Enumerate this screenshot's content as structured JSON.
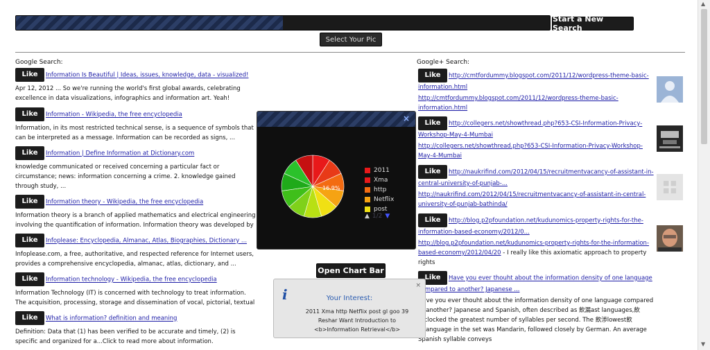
{
  "toolbar": {
    "progress": 0.5,
    "new_search_label": "Start a New Search",
    "select_pic_label": "Select Your Pic"
  },
  "google": {
    "title": "Google Search:",
    "like_label": "Like",
    "results": [
      {
        "title": "Information Is Beautiful | Ideas, issues, knowledge, data - visualized!",
        "snippet": "Apr 12, 2012 ... So we're running the world's first global awards, celebrating excellence in data visualizations, infographics and information art. Yeah!"
      },
      {
        "title": "Information - Wikipedia, the free encyclopedia",
        "snippet": "Information, in its most restricted technical sense, is a sequence of symbols that can be interpreted as a message. Information can be recorded as signs, ..."
      },
      {
        "title": "Information | Define Information at Dictionary.com",
        "snippet": "knowledge communicated or received concerning a particular fact or circumstance; news: information concerning a crime. 2. knowledge gained through study, ..."
      },
      {
        "title": "Information theory - Wikipedia, the free encyclopedia",
        "snippet": "Information theory is a branch of applied mathematics and electrical engineering involving the quantification of information. Information theory was developed by ..."
      },
      {
        "title": "Infoplease: Encyclopedia, Almanac, Atlas, Biographies, Dictionary ...",
        "snippet": "Infoplease.com, a free, authoritative, and respected reference for Internet users, provides a comprehensive encyclopedia, almanac, atlas, dictionary, and ..."
      },
      {
        "title": "Information technology - Wikipedia, the free encyclopedia",
        "snippet": "Information Technology (IT) is concerned with technology to treat information. The acquisition, processing, storage and dissemination of vocal, pictorial, textual ..."
      },
      {
        "title": "What is information? definition and meaning",
        "snippet": "Definition: Data that (1) has been verified to be accurate and timely, (2) is specific and organized for a...Click to read more about information."
      }
    ]
  },
  "gplus": {
    "title": "Google+ Search:",
    "like_label": "Like",
    "results": [
      {
        "link1": "http://cmtfordummy.blogspot.com/2011/12/wordpress-theme-basic-information.html",
        "link2": "http://cmtfordummy.blogspot.com/2011/12/wordpress-theme-basic-information.html",
        "text": ""
      },
      {
        "link1": "http://collegers.net/showthread.php?653-CSI-Information-Privacy-Workshop-May-4-Mumbai",
        "link2": "http://collegers.net/showthread.php?653-CSI-Information-Privacy-Workshop-May-4-Mumbai",
        "text": ""
      },
      {
        "link1": "http://naukrifind.com/2012/04/15/recruitmentvacancy-of-assistant-in-central-university-of-punjab-...",
        "link2": "http://naukrifind.com/2012/04/15/recruitmentvacancy-of-assistant-in-central-university-of-punjab-bathinda/",
        "text": ""
      },
      {
        "link1": "http://blog.p2pfoundation.net/kudunomics-property-rights-for-the-information-based-economy/2012/0...",
        "link2": "http://blog.p2pfoundation.net/kudunomics-property-rights-for-the-information-based-economy/2012/04/20",
        "text": " - I really like this axiomatic approach to property rights"
      },
      {
        "link1": "Have you ever thouht about the information density of one language compared to another? Japanese ...",
        "link2": "",
        "text": "Have you ever thouht about the information density of one language compared to another? Japanese and Spanish, often described as 飲漏ast languages,飲�clocked the greatest number of syllables per second. The 飲渉lowest飲�language in the set was Mandarin, followed closely by German. An average Spanish syllable conveys"
      }
    ]
  },
  "chart_popup": {
    "close_label": "×",
    "open_chart_label": "Open Chart Bar",
    "nav_label": "1/2"
  },
  "chart_data": {
    "type": "pie",
    "title": "",
    "categories": [
      "2011",
      "Xma",
      "http",
      "Netflix",
      "post"
    ],
    "values": [
      16.9,
      16.9,
      16.9,
      16.9,
      16.9
    ],
    "colors": [
      "#e8191a",
      "#e8191a",
      "#f36b12",
      "#f6a313",
      "#f0e014"
    ],
    "slice_label": "16.9%",
    "legend_position": "right"
  },
  "interest": {
    "title": "Your Interest:",
    "lines": [
      "2011 Xma http Netflix post gl goo 39",
      "Reshar Want Introduction to",
      "<b>Information Retrieval</b>"
    ],
    "close_label": "×"
  }
}
